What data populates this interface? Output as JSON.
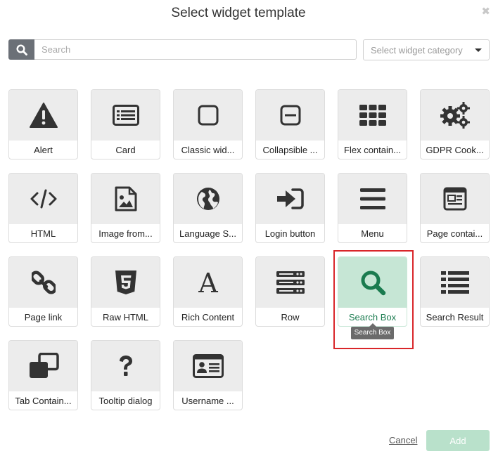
{
  "dialog": {
    "title": "Select widget template",
    "close_icon": "close-icon"
  },
  "search": {
    "placeholder": "Search",
    "icon": "search-icon"
  },
  "category": {
    "placeholder": "Select widget category"
  },
  "widgets": [
    {
      "label": "Alert",
      "icon": "warning-icon"
    },
    {
      "label": "Card",
      "icon": "card-list-icon"
    },
    {
      "label": "Classic wid...",
      "icon": "square-icon"
    },
    {
      "label": "Collapsible ...",
      "icon": "minus-square-icon"
    },
    {
      "label": "Flex contain...",
      "icon": "grid-icon"
    },
    {
      "label": "GDPR Cook...",
      "icon": "gears-icon"
    },
    {
      "label": "HTML",
      "icon": "code-icon"
    },
    {
      "label": "Image from...",
      "icon": "image-file-icon"
    },
    {
      "label": "Language S...",
      "icon": "globe-icon"
    },
    {
      "label": "Login button",
      "icon": "sign-in-icon"
    },
    {
      "label": "Menu",
      "icon": "hamburger-icon"
    },
    {
      "label": "Page contai...",
      "icon": "page-icon"
    },
    {
      "label": "Page link",
      "icon": "link-icon"
    },
    {
      "label": "Raw HTML",
      "icon": "html5-icon"
    },
    {
      "label": "Rich Content",
      "icon": "font-icon"
    },
    {
      "label": "Row",
      "icon": "server-icon"
    },
    {
      "label": "Search Box",
      "icon": "search-icon",
      "selected": true
    },
    {
      "label": "Search Result",
      "icon": "list-icon"
    },
    {
      "label": "Tab Contain...",
      "icon": "clone-icon"
    },
    {
      "label": "Tooltip dialog",
      "icon": "question-icon"
    },
    {
      "label": "Username ...",
      "icon": "id-card-icon"
    }
  ],
  "tooltip": "Search Box",
  "actions": {
    "cancel_label": "Cancel",
    "add_label": "Add"
  },
  "colors": {
    "icon": "#333333",
    "selected_icon": "#1a7b4f",
    "selected_bg": "#c6e6d5",
    "highlight": "#d9262a",
    "add_button": "#b9e1cb"
  }
}
